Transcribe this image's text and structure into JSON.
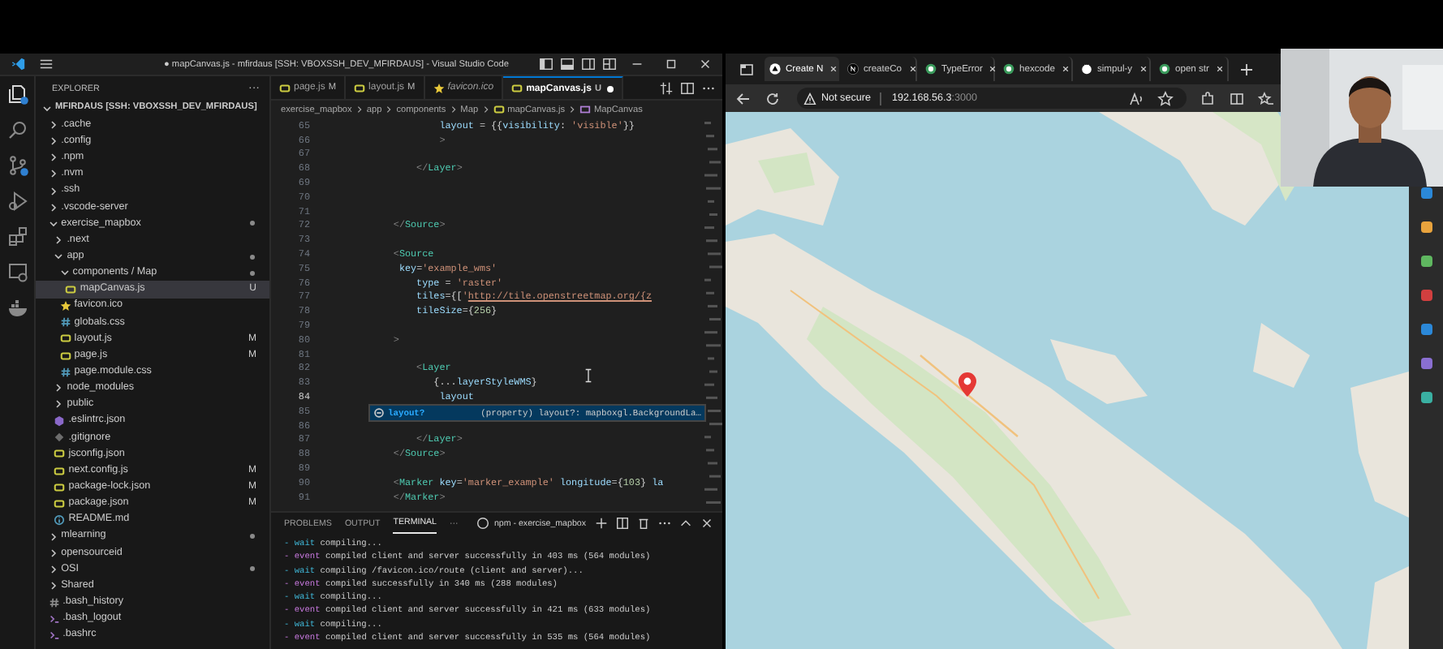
{
  "vscode": {
    "title": "● mapCanvas.js - mfirdaus [SSH: VBOXSSH_DEV_MFIRDAUS] - Visual Studio Code",
    "explorer": {
      "heading": "EXPLORER",
      "more": "···",
      "root": {
        "label": "MFIRDAUS [SSH: VBOXSSH_DEV_MFIRDAUS]",
        "expanded": true
      },
      "items": [
        {
          "label": ".cache",
          "kind": "folder",
          "expanded": false,
          "changed": false,
          "selected": false
        },
        {
          "label": ".config",
          "kind": "folder",
          "expanded": false,
          "changed": false,
          "selected": false
        },
        {
          "label": ".npm",
          "kind": "folder",
          "expanded": false,
          "changed": false,
          "selected": false
        },
        {
          "label": ".nvm",
          "kind": "folder",
          "expanded": false,
          "changed": false,
          "selected": false
        },
        {
          "label": ".ssh",
          "kind": "folder",
          "expanded": false,
          "changed": false,
          "selected": false
        },
        {
          "label": ".vscode-server",
          "kind": "folder",
          "expanded": false,
          "changed": false,
          "selected": false
        },
        {
          "label": "exercise_mapbox",
          "kind": "folder",
          "expanded": true,
          "changed": true,
          "selected": false,
          "children": [
            {
              "label": ".next",
              "kind": "folder",
              "expanded": false,
              "changed": false,
              "selected": false
            },
            {
              "label": "app",
              "kind": "folder",
              "expanded": true,
              "changed": true,
              "selected": false,
              "children": [
                {
                  "label": "components / Map",
                  "kind": "folder",
                  "expanded": true,
                  "changed": true,
                  "selected": false,
                  "children": [
                    {
                      "label": "mapCanvas.js",
                      "kind": "js",
                      "status": "U",
                      "changed": true,
                      "selected": true
                    }
                  ]
                },
                {
                  "label": "favicon.ico",
                  "kind": "ico",
                  "changed": false,
                  "selected": false
                },
                {
                  "label": "globals.css",
                  "kind": "css",
                  "changed": false,
                  "selected": false
                },
                {
                  "label": "layout.js",
                  "kind": "js",
                  "status": "M",
                  "changed": true,
                  "selected": false
                },
                {
                  "label": "page.js",
                  "kind": "js",
                  "status": "M",
                  "changed": true,
                  "selected": false
                },
                {
                  "label": "page.module.css",
                  "kind": "css",
                  "changed": false,
                  "selected": false
                }
              ]
            },
            {
              "label": "node_modules",
              "kind": "folder",
              "expanded": false,
              "changed": false,
              "selected": false
            },
            {
              "label": "public",
              "kind": "folder",
              "expanded": false,
              "changed": false,
              "selected": false
            },
            {
              "label": ".eslintrc.json",
              "kind": "eslint",
              "changed": false,
              "selected": false
            },
            {
              "label": ".gitignore",
              "kind": "git",
              "changed": false,
              "selected": false
            },
            {
              "label": "jsconfig.json",
              "kind": "json",
              "changed": false,
              "selected": false
            },
            {
              "label": "next.config.js",
              "kind": "js",
              "status": "M",
              "changed": true,
              "selected": false
            },
            {
              "label": "package-lock.json",
              "kind": "json",
              "status": "M",
              "changed": true,
              "selected": false
            },
            {
              "label": "package.json",
              "kind": "json",
              "status": "M",
              "changed": true,
              "selected": false
            },
            {
              "label": "README.md",
              "kind": "md",
              "changed": false,
              "selected": false
            }
          ]
        },
        {
          "label": "mlearning",
          "kind": "folder",
          "expanded": false,
          "changed": true,
          "selected": false
        },
        {
          "label": "opensourceid",
          "kind": "folder",
          "expanded": false,
          "changed": false,
          "selected": false
        },
        {
          "label": "OSI",
          "kind": "folder",
          "expanded": false,
          "changed": true,
          "selected": false
        },
        {
          "label": "Shared",
          "kind": "folder",
          "expanded": false,
          "changed": false,
          "selected": false
        },
        {
          "label": ".bash_history",
          "kind": "history",
          "changed": false,
          "selected": false
        },
        {
          "label": ".bash_logout",
          "kind": "shell",
          "changed": false,
          "selected": false
        },
        {
          "label": ".bashrc",
          "kind": "shell",
          "changed": false,
          "selected": false
        }
      ]
    },
    "tabs": [
      {
        "label": "page.js",
        "status": "M",
        "kind": "js",
        "selected": false,
        "dirty": false
      },
      {
        "label": "layout.js",
        "status": "M",
        "kind": "js",
        "selected": false,
        "dirty": false
      },
      {
        "label": "favicon.ico",
        "kind": "ico",
        "selected": false,
        "dirty": false
      },
      {
        "label": "mapCanvas.js",
        "status": "U",
        "kind": "js",
        "selected": true,
        "dirty": true
      }
    ],
    "breadcrumb": [
      "exercise_mapbox",
      "app",
      "components",
      "Map",
      "mapCanvas.js",
      "MapCanvas"
    ],
    "code_lines": [
      {
        "number": "65",
        "current": false,
        "tokens": [
          {
            "kind": "attr",
            "t": "                    layout"
          },
          {
            "kind": "plain",
            "t": " = {{"
          },
          {
            "kind": "attr",
            "t": "visibility"
          },
          {
            "kind": "plain",
            "t": ": "
          },
          {
            "kind": "str",
            "t": "'visible'"
          },
          {
            "kind": "plain",
            "t": "}}"
          }
        ]
      },
      {
        "number": "66",
        "current": false,
        "tokens": [
          {
            "kind": "punct",
            "t": "                    >"
          }
        ]
      },
      {
        "number": "67",
        "current": false
      },
      {
        "number": "68",
        "current": false,
        "tokens": [
          {
            "kind": "punct",
            "t": "                </"
          },
          {
            "kind": "tag",
            "t": "Layer"
          },
          {
            "kind": "punct",
            "t": ">"
          }
        ]
      },
      {
        "number": "69",
        "current": false
      },
      {
        "number": "70",
        "current": false
      },
      {
        "number": "71",
        "current": false
      },
      {
        "number": "72",
        "current": false,
        "tokens": [
          {
            "kind": "punct",
            "t": "            </"
          },
          {
            "kind": "tag",
            "t": "Source"
          },
          {
            "kind": "punct",
            "t": ">"
          }
        ]
      },
      {
        "number": "73",
        "current": false
      },
      {
        "number": "74",
        "current": false,
        "tokens": [
          {
            "kind": "punct",
            "t": "            <"
          },
          {
            "kind": "tag",
            "t": "Source"
          }
        ]
      },
      {
        "number": "75",
        "current": false,
        "tokens": [
          {
            "kind": "attr",
            "t": "             key"
          },
          {
            "kind": "plain",
            "t": "="
          },
          {
            "kind": "str",
            "t": "'example_wms'"
          }
        ]
      },
      {
        "number": "76",
        "current": false,
        "tokens": [
          {
            "kind": "attr",
            "t": "                type"
          },
          {
            "kind": "plain",
            "t": " = "
          },
          {
            "kind": "str",
            "t": "'raster'"
          }
        ]
      },
      {
        "number": "77",
        "current": false,
        "tokens": [
          {
            "kind": "attr",
            "t": "                tiles"
          },
          {
            "kind": "plain",
            "t": "={["
          },
          {
            "kind": "str",
            "t": "'"
          },
          {
            "kind": "link",
            "t": "http://tile.openstreetmap.org/{z"
          }
        ]
      },
      {
        "number": "78",
        "current": false,
        "tokens": [
          {
            "kind": "attr",
            "t": "                tileSize"
          },
          {
            "kind": "plain",
            "t": "={"
          },
          {
            "kind": "num",
            "t": "256"
          },
          {
            "kind": "plain",
            "t": "}"
          }
        ]
      },
      {
        "number": "79",
        "current": false
      },
      {
        "number": "80",
        "current": false,
        "tokens": [
          {
            "kind": "punct",
            "t": "            >"
          }
        ]
      },
      {
        "number": "81",
        "current": false
      },
      {
        "number": "82",
        "current": false,
        "tokens": [
          {
            "kind": "punct",
            "t": "                <"
          },
          {
            "kind": "tag",
            "t": "Layer"
          }
        ]
      },
      {
        "number": "83",
        "current": false,
        "tokens": [
          {
            "kind": "plain",
            "t": "                   {..."
          },
          {
            "kind": "attr",
            "t": "layerStyleWMS"
          },
          {
            "kind": "plain",
            "t": "}"
          }
        ]
      },
      {
        "number": "84",
        "current": true,
        "tokens": [
          {
            "kind": "attr",
            "t": "                    layout"
          }
        ]
      },
      {
        "number": "85",
        "current": false
      },
      {
        "number": "86",
        "current": false
      },
      {
        "number": "87",
        "current": false,
        "tokens": [
          {
            "kind": "punct",
            "t": "                </"
          },
          {
            "kind": "tag",
            "t": "Layer"
          },
          {
            "kind": "punct",
            "t": ">"
          }
        ]
      },
      {
        "number": "88",
        "current": false,
        "tokens": [
          {
            "kind": "punct",
            "t": "            </"
          },
          {
            "kind": "tag",
            "t": "Source"
          },
          {
            "kind": "punct",
            "t": ">"
          }
        ]
      },
      {
        "number": "89",
        "current": false
      },
      {
        "number": "90",
        "current": false,
        "tokens": [
          {
            "kind": "punct",
            "t": "            <"
          },
          {
            "kind": "tag",
            "t": "Marker"
          },
          {
            "kind": "attr",
            "t": " key"
          },
          {
            "kind": "plain",
            "t": "="
          },
          {
            "kind": "str",
            "t": "'marker_example'"
          },
          {
            "kind": "attr",
            "t": " longitude"
          },
          {
            "kind": "plain",
            "t": "={"
          },
          {
            "kind": "num",
            "t": "103"
          },
          {
            "kind": "plain",
            "t": "} "
          },
          {
            "kind": "attr",
            "t": "la"
          }
        ]
      },
      {
        "number": "91",
        "current": false,
        "tokens": [
          {
            "kind": "punct",
            "t": "            </"
          },
          {
            "kind": "tag",
            "t": "Marker"
          },
          {
            "kind": "punct",
            "t": ">"
          }
        ]
      }
    ],
    "suggestion": {
      "label": "layout?",
      "detail": "(property) layout?: mapboxgl.BackgroundLa…"
    },
    "panel": {
      "tabs": [
        {
          "label": "PROBLEMS",
          "selected": false
        },
        {
          "label": "OUTPUT",
          "selected": false
        },
        {
          "label": "TERMINAL",
          "selected": true
        }
      ],
      "more": "···",
      "terminal_name": "npm - exercise_mapbox",
      "lines": [
        {
          "kind": "wait",
          "dash": "-",
          "label": "wait",
          "message": "compiling..."
        },
        {
          "kind": "event",
          "dash": "-",
          "label": "event",
          "message": "compiled client and server successfully in 403 ms (564 modules)"
        },
        {
          "kind": "wait",
          "dash": "-",
          "label": "wait",
          "message": "compiling /favicon.ico/route (client and server)..."
        },
        {
          "kind": "event",
          "dash": "-",
          "label": "event",
          "message": "compiled successfully in 340 ms (288 modules)"
        },
        {
          "kind": "wait",
          "dash": "-",
          "label": "wait",
          "message": "compiling..."
        },
        {
          "kind": "event",
          "dash": "-",
          "label": "event",
          "message": "compiled client and server successfully in 421 ms (633 modules)"
        },
        {
          "kind": "wait",
          "dash": "-",
          "label": "wait",
          "message": "compiling..."
        },
        {
          "kind": "event",
          "dash": "-",
          "label": "event",
          "message": "compiled client and server successfully in 535 ms (564 modules)"
        }
      ]
    }
  },
  "browser": {
    "tabs": [
      {
        "label": "Create N",
        "kind": "triangle",
        "selected": true
      },
      {
        "label": "createCo",
        "kind": "n",
        "selected": false
      },
      {
        "label": "TypeError",
        "kind": "globe",
        "selected": false
      },
      {
        "label": "hexcode",
        "kind": "globe",
        "selected": false
      },
      {
        "label": "simpul-y",
        "kind": "cat",
        "selected": false
      },
      {
        "label": "open str",
        "kind": "globe",
        "selected": false
      }
    ],
    "address": {
      "security": "Not secure",
      "host": "192.168.56.3",
      "port": ":3000"
    },
    "map": {
      "marker": true
    }
  }
}
